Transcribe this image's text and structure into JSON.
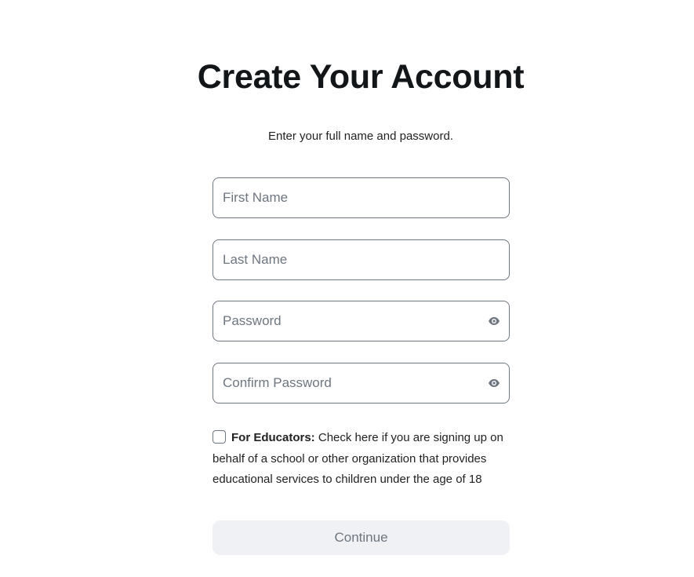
{
  "header": {
    "title": "Create Your Account",
    "subtitle": "Enter your full name and password."
  },
  "form": {
    "first_name": {
      "placeholder": "First Name",
      "value": ""
    },
    "last_name": {
      "placeholder": "Last Name",
      "value": ""
    },
    "password": {
      "placeholder": "Password",
      "value": "",
      "icon": "eye-icon"
    },
    "confirm_password": {
      "placeholder": "Confirm Password",
      "value": "",
      "icon": "eye-icon"
    },
    "educators": {
      "checked": false,
      "label_bold": "For Educators:",
      "label_text": "Check here if you are signing up on behalf of a school or other organization that provides educational services to children under the age of 18"
    },
    "continue_label": "Continue"
  },
  "colors": {
    "field_border": "#6e7680",
    "placeholder": "#6e7680",
    "button_bg": "#eff1f4",
    "button_text": "#6e7680",
    "title_text": "#131619"
  }
}
